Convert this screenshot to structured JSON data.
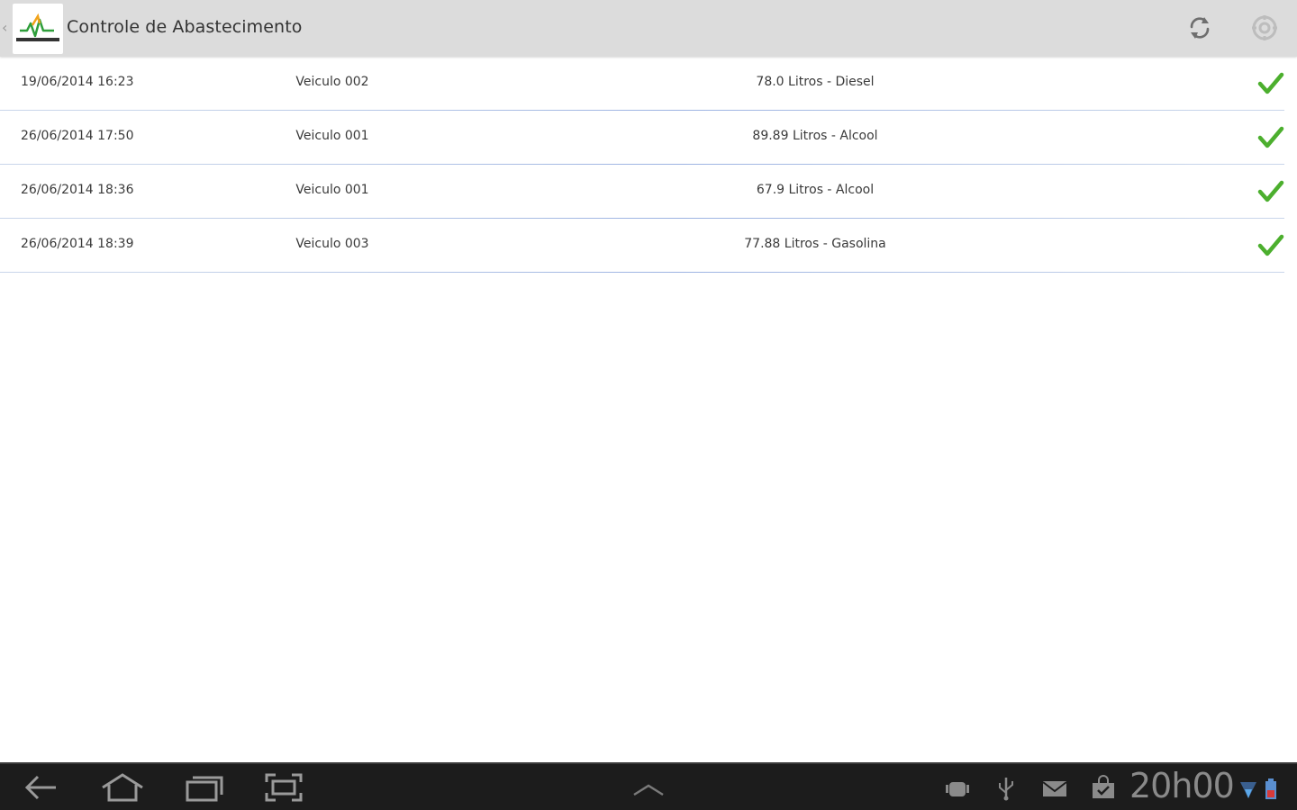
{
  "action_bar": {
    "title": "Controle de Abastecimento",
    "logo_icon": "brand-logo",
    "refresh_icon": "refresh-icon",
    "settings_icon": "settings-icon"
  },
  "records": [
    {
      "datetime": "19/06/2014 16:23",
      "vehicle": "Veiculo 002",
      "fuel": "78.0 Litros - Diesel",
      "status_icon": "check-icon"
    },
    {
      "datetime": "26/06/2014 17:50",
      "vehicle": "Veiculo 001",
      "fuel": "89.89 Litros - Alcool",
      "status_icon": "check-icon"
    },
    {
      "datetime": "26/06/2014 18:36",
      "vehicle": "Veiculo 001",
      "fuel": "67.9 Litros - Alcool",
      "status_icon": "check-icon"
    },
    {
      "datetime": "26/06/2014 18:39",
      "vehicle": "Veiculo 003",
      "fuel": "77.88 Litros - Gasolina",
      "status_icon": "check-icon"
    }
  ],
  "system_bar": {
    "clock": "20h00",
    "buttons": [
      "back-icon",
      "home-icon",
      "recent-apps-icon",
      "screenshot-icon"
    ],
    "notifications": [
      "android-debug-icon",
      "usb-icon",
      "mail-icon",
      "store-icon"
    ]
  },
  "colors": {
    "action_bar_bg": "#dcdcdc",
    "check_green": "#4caf2e",
    "system_bar_bg": "#1c1c1c",
    "divider": "#c9d6ea"
  }
}
